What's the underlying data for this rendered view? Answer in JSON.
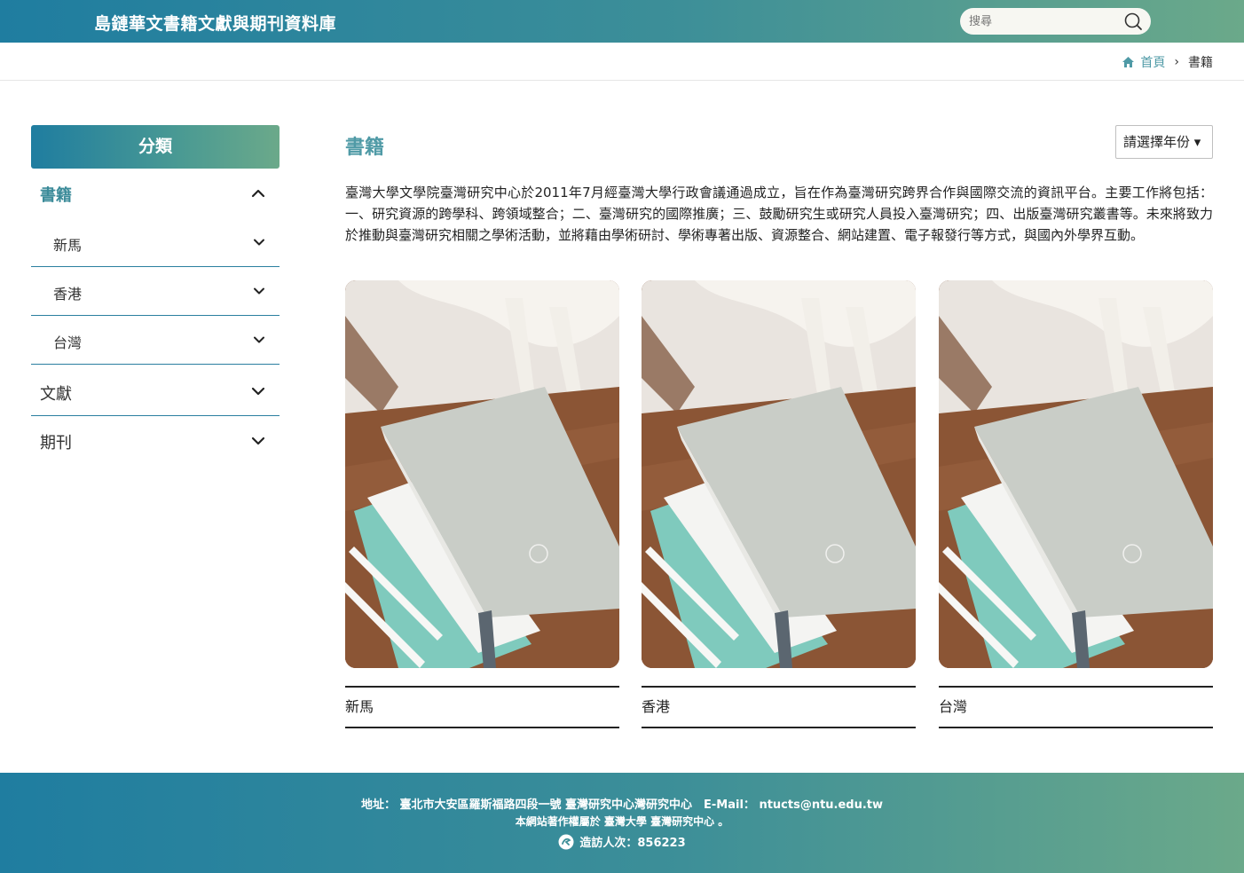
{
  "header": {
    "site_title": "島鏈華文書籍文獻與期刊資料庫",
    "search_placeholder": "搜尋",
    "search_icon": "search-icon"
  },
  "breadcrumb": {
    "home": "首頁",
    "separator": "›",
    "current": "書籍"
  },
  "sidebar": {
    "heading": "分類",
    "categories": [
      {
        "label": "書籍",
        "expanded": true,
        "children": [
          {
            "label": "新馬"
          },
          {
            "label": "香港"
          },
          {
            "label": "台灣"
          }
        ]
      },
      {
        "label": "文獻",
        "expanded": false
      },
      {
        "label": "期刊",
        "expanded": false
      }
    ]
  },
  "main": {
    "title": "書籍",
    "year_select": "請選擇年份 ▾",
    "intro": "臺灣大學文學院臺灣研究中心於2011年7月經臺灣大學行政會議通過成立，旨在作為臺灣研究跨界合作與國際交流的資訊平台。主要工作將包括：一、研究資源的跨學科、跨領域整合；二、臺灣研究的國際推廣；三、鼓勵研究生或研究人員投入臺灣研究；四、出版臺灣研究叢書等。未來將致力於推動與臺灣研究相關之學術活動，並將藉由學術研討、學術專著出版、資源整合、網站建置、電子報發行等方式，與國內外學界互動。",
    "cards": [
      {
        "label": "新馬"
      },
      {
        "label": "香港"
      },
      {
        "label": "台灣"
      }
    ]
  },
  "footer": {
    "address": "地址： 臺北市大安區羅斯福路四段一號 臺灣研究中心灣研究中心　E-Mail： ntucts@ntu.edu.tw",
    "copyright": "本網站著作權屬於 臺灣大學 臺灣研究中心 。",
    "visitors": "造訪人次：856223"
  },
  "colors": {
    "brand_start": "#1f7da0",
    "brand_end": "#6ba98a",
    "accent_text": "#4f9aa6"
  }
}
